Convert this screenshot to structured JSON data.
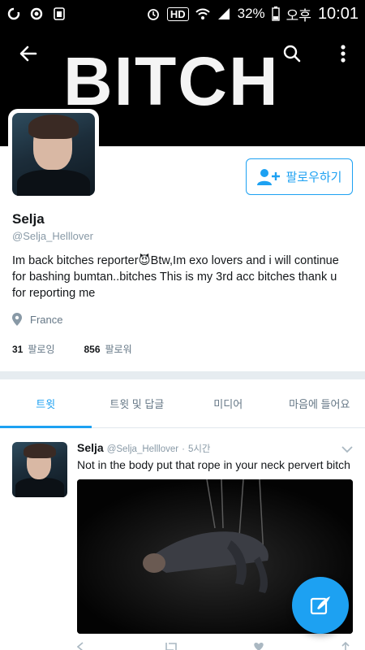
{
  "status_bar": {
    "battery": "32%",
    "ampm": "오후",
    "time": "10:01",
    "hd": "HD"
  },
  "header": {
    "banner_text": "BITCH",
    "back_icon": "arrow-left-icon",
    "search_icon": "search-icon",
    "more_icon": "more-vertical-icon"
  },
  "profile": {
    "display_name": "Selja",
    "handle": "@Selja_Helllover",
    "bio_line1": "Im back bitches reporter😈Btw,Im exo lovers and i will continue",
    "bio_line2": "for bashing bumtan..bitches  This is my 3rd acc bitches thank u",
    "bio_line3": "for reporting me",
    "location": "France",
    "following_count": "31",
    "following_label": "팔로잉",
    "followers_count": "856",
    "followers_label": "팔로워",
    "follow_button": "팔로우하기"
  },
  "tabs": [
    {
      "label": "트윗",
      "active": true
    },
    {
      "label": "트윗 및 답글",
      "active": false
    },
    {
      "label": "미디어",
      "active": false
    },
    {
      "label": "마음에 들어요",
      "active": false
    }
  ],
  "tweet": {
    "name": "Selja",
    "handle": "@Selja_Helllover",
    "separator": "·",
    "time": "5시간",
    "text": "Not in the body put that rope in your neck pervert bitch"
  },
  "colors": {
    "accent": "#1da1f2",
    "header_bg": "#000000",
    "muted_text": "#8899a6"
  }
}
